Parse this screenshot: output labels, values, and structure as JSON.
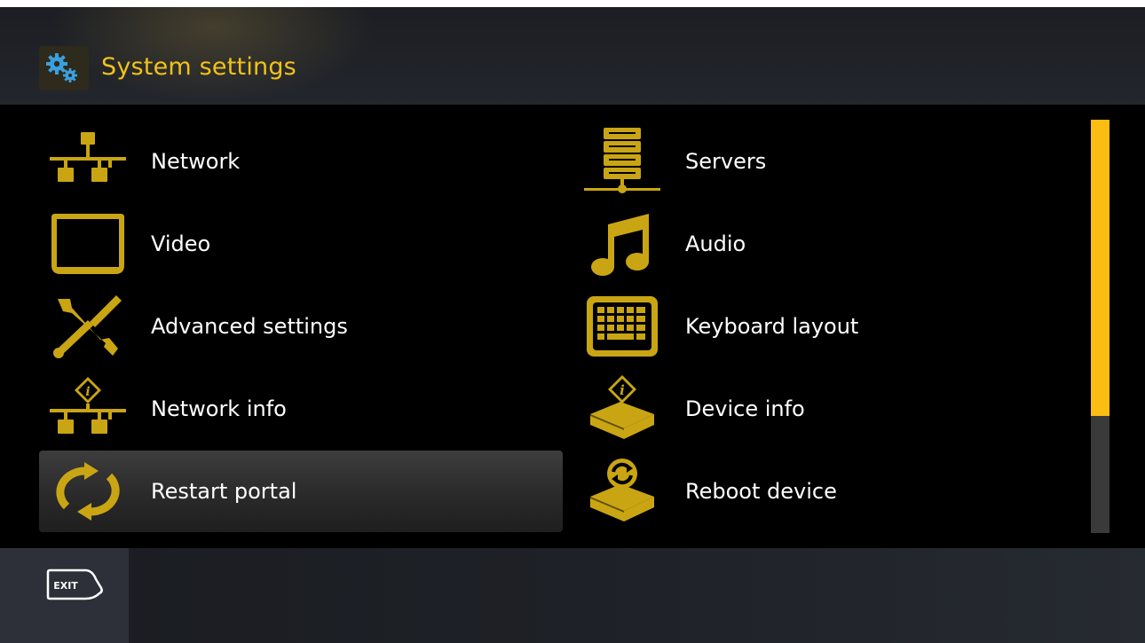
{
  "header": {
    "title": "System settings",
    "icon": "gears-icon"
  },
  "menu": {
    "left": [
      {
        "label": "Network",
        "icon": "network-icon"
      },
      {
        "label": "Video",
        "icon": "monitor-icon"
      },
      {
        "label": "Advanced settings",
        "icon": "wrench-screwdriver-icon"
      },
      {
        "label": "Network info",
        "icon": "network-info-icon"
      },
      {
        "label": "Restart portal",
        "icon": "restart-arrows-icon",
        "selected": true
      }
    ],
    "right": [
      {
        "label": "Servers",
        "icon": "server-icon"
      },
      {
        "label": "Audio",
        "icon": "music-note-icon"
      },
      {
        "label": "Keyboard layout",
        "icon": "keyboard-icon"
      },
      {
        "label": "Device info",
        "icon": "device-info-icon"
      },
      {
        "label": "Reboot device",
        "icon": "reboot-device-icon"
      }
    ]
  },
  "footer": {
    "exit_label": "EXIT"
  },
  "colors": {
    "accent": "#fbbd12",
    "icon": "#c9a514",
    "title": "#f2c21a",
    "background": "#000000"
  }
}
